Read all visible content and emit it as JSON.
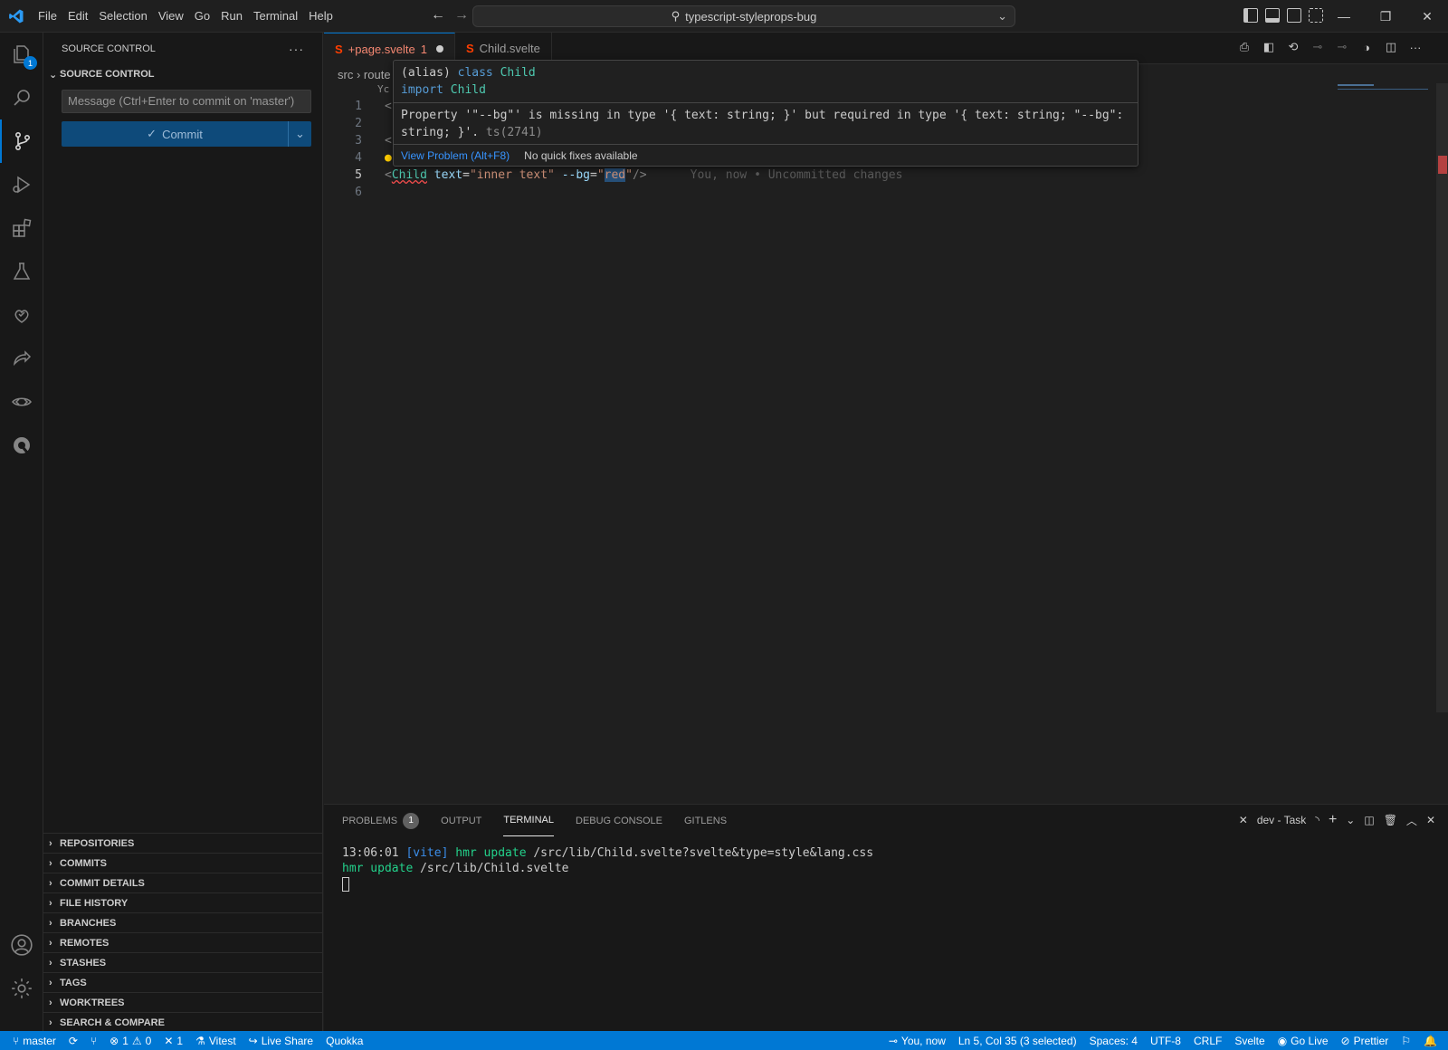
{
  "menu": [
    "File",
    "Edit",
    "Selection",
    "View",
    "Go",
    "Run",
    "Terminal",
    "Help"
  ],
  "command_center": "typescript-styleprops-bug",
  "activity": {
    "explorer_badge": "1"
  },
  "sidebar": {
    "header": "SOURCE CONTROL",
    "section": "SOURCE CONTROL",
    "commit_placeholder": "Message (Ctrl+Enter to commit on 'master')",
    "commit_label": "Commit",
    "bottom_sections": [
      "REPOSITORIES",
      "COMMITS",
      "COMMIT DETAILS",
      "FILE HISTORY",
      "BRANCHES",
      "REMOTES",
      "STASHES",
      "TAGS",
      "WORKTREES",
      "SEARCH & COMPARE"
    ]
  },
  "tabs": [
    {
      "label": "+page.svelte",
      "count": "1"
    },
    {
      "label": "Child.svelte"
    }
  ],
  "breadcrumb": {
    "part1": "src",
    "part2": "route"
  },
  "code": {
    "line_numbers": [
      "1",
      "2",
      "3",
      "4",
      "5",
      "6"
    ],
    "line5": {
      "open": "<",
      "tag": "Child",
      "attr1": "text",
      "eq1": "=",
      "val1": "\"inner text\"",
      "attr2": "--bg",
      "eq2": "=",
      "q_open": "\"",
      "selected": "red",
      "q_close": "\"",
      "close": "/>",
      "blame": "You, now • Uncommitted changes"
    },
    "partial": {
      "l1": "<",
      "l3": "<",
      "above": "Yc"
    }
  },
  "hover": {
    "l1_alias": "(alias)",
    "l1_kw": "class",
    "l1_name": "Child",
    "l2_kw": "import",
    "l2_name": "Child",
    "message_l1": "Property '\"--bg\"' is missing in type '{ text: string; }' but required in type '{ text: string; \"--bg\":",
    "message_l2": "string; }'.",
    "code": "ts(2741)",
    "view_problem": "View Problem (Alt+F8)",
    "no_fix": "No quick fixes available"
  },
  "panel": {
    "tabs": [
      "PROBLEMS",
      "OUTPUT",
      "TERMINAL",
      "DEBUG CONSOLE",
      "GITLENS"
    ],
    "problems_count": "1",
    "task": "dev - Task",
    "terminal": {
      "l1_time": "13:06:01",
      "l1_vite": "[vite]",
      "l1_hmr": "hmr update",
      "l1_path": "/src/lib/Child.svelte?svelte&type=style&lang.css",
      "l2_hmr": "hmr update",
      "l2_path": "/src/lib/Child.svelte"
    }
  },
  "status": {
    "branch": "master",
    "errors": "1",
    "warnings": "0",
    "ports": "1",
    "vitest": "Vitest",
    "liveshare": "Live Share",
    "quokka": "Quokka",
    "blame": "You, now",
    "position": "Ln 5, Col 35 (3 selected)",
    "spaces": "Spaces: 4",
    "encoding": "UTF-8",
    "eol": "CRLF",
    "language": "Svelte",
    "golive": "Go Live",
    "prettier": "Prettier"
  },
  "colors": {
    "accent": "#0078d4",
    "svelte": "#f48771",
    "error": "#f14c4c"
  }
}
